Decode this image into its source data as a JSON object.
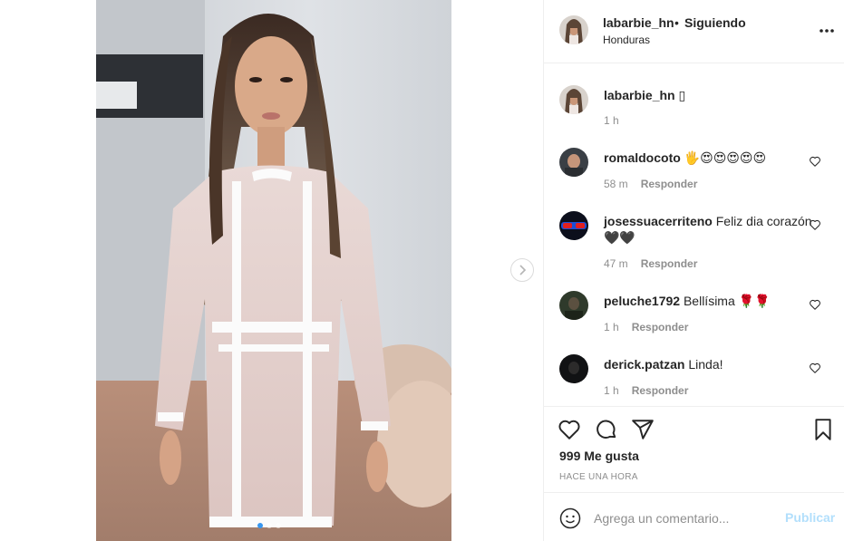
{
  "post": {
    "username": "labarbie_hn",
    "separator": "•",
    "follow_status": "Siguiendo",
    "location": "Honduras",
    "carousel": {
      "total": 3,
      "active_index": 0
    }
  },
  "caption": {
    "username": "labarbie_hn",
    "text": "▯",
    "time": "1 h"
  },
  "comments": [
    {
      "username": "romaldocoto",
      "text": "🖐😍😍😍😍😍",
      "time": "58 m",
      "reply_label": "Responder"
    },
    {
      "username": "josessuacerriteno",
      "text": "Feliz dia corazón🖤🖤",
      "time": "47 m",
      "reply_label": "Responder"
    },
    {
      "username": "peluche1792",
      "text": "Bellísima 🌹🌹",
      "time": "1 h",
      "reply_label": "Responder"
    },
    {
      "username": "derick.patzan",
      "text": "Linda!",
      "time": "1 h",
      "reply_label": "Responder"
    }
  ],
  "actions": {
    "likes": "999 Me gusta",
    "posted_ago": "HACE UNA HORA"
  },
  "comment_box": {
    "placeholder": "Agrega un comentario...",
    "publish_label": "Publicar"
  },
  "icons": [
    "more-options-icon",
    "chevron-right-icon",
    "heart-icon",
    "comment-icon",
    "share-icon",
    "bookmark-icon",
    "emoji-icon"
  ],
  "colors": {
    "accent": "#3897f0",
    "publish_disabled": "#b2dffc",
    "text": "#262626",
    "muted": "#8e8e8e",
    "border": "#efefef"
  }
}
